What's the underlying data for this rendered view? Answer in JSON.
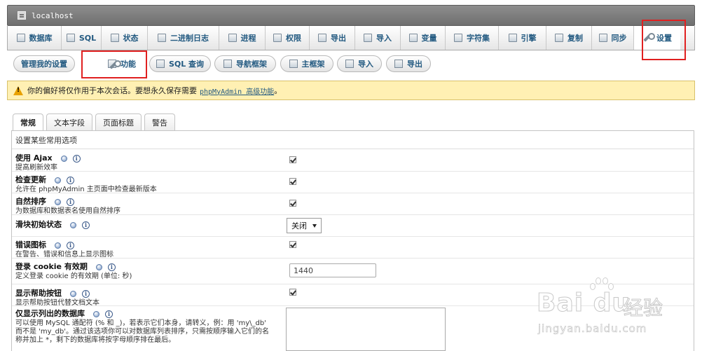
{
  "window": {
    "title": "localhost",
    "icon": "server-icon"
  },
  "main_tabs": [
    {
      "label": "数据库",
      "icon": "database-icon",
      "active": false
    },
    {
      "label": "SQL",
      "icon": "sql-icon",
      "active": false
    },
    {
      "label": "状态",
      "icon": "status-chart-icon",
      "active": false
    },
    {
      "label": "二进制日志",
      "icon": "binlog-icon",
      "active": false
    },
    {
      "label": "进程",
      "icon": "process-gear-icon",
      "active": false
    },
    {
      "label": "权限",
      "icon": "privileges-icon",
      "active": false
    },
    {
      "label": "导出",
      "icon": "export-icon",
      "active": false
    },
    {
      "label": "导入",
      "icon": "import-icon",
      "active": false
    },
    {
      "label": "变量",
      "icon": "variables-icon",
      "active": false
    },
    {
      "label": "字符集",
      "icon": "charset-icon",
      "active": false
    },
    {
      "label": "引擎",
      "icon": "engine-icon",
      "active": false
    },
    {
      "label": "复制",
      "icon": "replication-icon",
      "active": false
    },
    {
      "label": "同步",
      "icon": "sync-icon",
      "active": false
    },
    {
      "label": "设置",
      "icon": "wrench-icon",
      "active": true
    }
  ],
  "sub_tabs": [
    {
      "label": "管理我的设置",
      "icon": "",
      "active": false
    },
    {
      "label": "功能",
      "icon": "wrench-icon",
      "active": true
    },
    {
      "label": "SQL 查询",
      "icon": "sql-query-icon",
      "active": false
    },
    {
      "label": "导航框架",
      "icon": "navigation-frame-icon",
      "active": false
    },
    {
      "label": "主框架",
      "icon": "main-frame-icon",
      "active": false
    },
    {
      "label": "导入",
      "icon": "import-icon",
      "active": false
    },
    {
      "label": "导出",
      "icon": "export-icon",
      "active": false
    }
  ],
  "notice": {
    "icon": "warning-icon",
    "text": "你的偏好将仅作用于本次会话。要想永久保存需要",
    "link": "phpMyAdmin 高级功能",
    "suffix": "。"
  },
  "settings_tabs": [
    {
      "label": "常规",
      "active": true
    },
    {
      "label": "文本字段",
      "active": false
    },
    {
      "label": "页面标题",
      "active": false
    },
    {
      "label": "警告",
      "active": false
    }
  ],
  "form": {
    "heading": "设置某些常用选项",
    "rows": [
      {
        "name": "使用 Ajax",
        "desc": "提高刷新效率",
        "control": "checkbox",
        "checked": true
      },
      {
        "name": "检查更新",
        "desc": "允许在 phpMyAdmin 主页面中检查最新版本",
        "control": "checkbox",
        "checked": true
      },
      {
        "name": "自然排序",
        "desc": "为数据库和数据表名使用自然排序",
        "control": "checkbox",
        "checked": true
      },
      {
        "name": "滑块初始状态",
        "desc": "",
        "control": "select",
        "value": "关闭"
      },
      {
        "name": "错误图标",
        "desc": "在警告、错误和信息上显示图标",
        "control": "checkbox",
        "checked": true
      },
      {
        "name": "登录 cookie 有效期",
        "desc": "定义登录 cookie 的有效期 (单位: 秒)",
        "control": "text",
        "value": "1440"
      },
      {
        "name": "显示帮助按钮",
        "desc": "显示帮助按钮代替文档文本",
        "control": "checkbox",
        "checked": true
      },
      {
        "name": "仅显示列出的数据库",
        "desc_lines": [
          "可以使用 MySQL 通配符 (% 和 _)，若表示它们本身，请转义，例：用 'my\\_db'",
          "而不是 'my_db'。通过该选项你可以对数据库列表排序，只需按顺序输入它们的名",
          "称并加上 *，剩下的数据库将按字母顺序排在最后。"
        ],
        "control": "textarea",
        "value": ""
      }
    ]
  },
  "watermark": {
    "brand": "Bai du",
    "cn": "经验",
    "url": "jingyan.baidu.com"
  },
  "colors": {
    "link": "#235a81",
    "notice_bg": "#fff0b3",
    "highlight": "#e02020",
    "titlebar": "#7a7a7a"
  }
}
